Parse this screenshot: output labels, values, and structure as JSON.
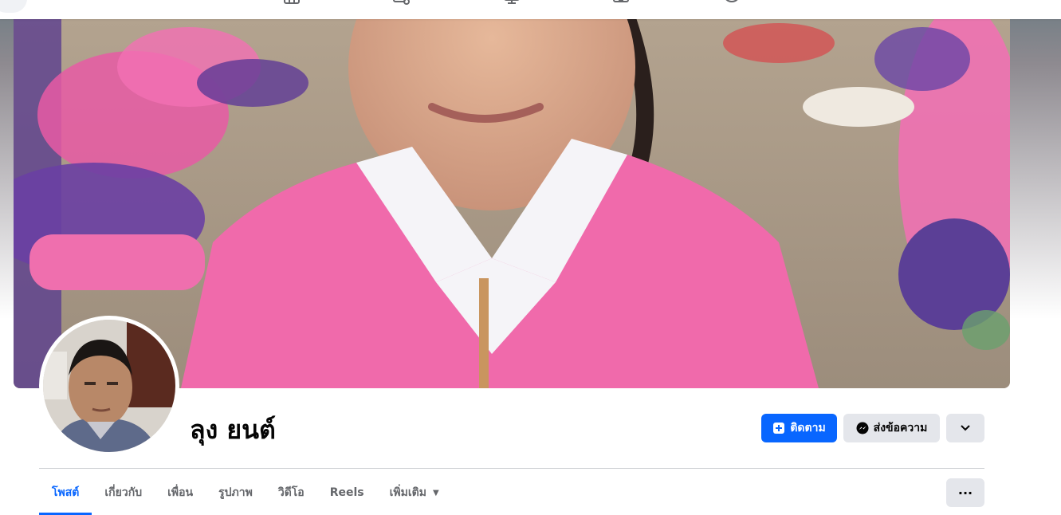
{
  "topnav": {
    "icons": [
      "home-icon",
      "video-icon",
      "marketplace-icon",
      "groups-icon",
      "gaming-icon"
    ]
  },
  "profile": {
    "name": "ลุง ยนต์"
  },
  "actions": {
    "follow_label": "ติดตาม",
    "message_label": "ส่งข้อความ"
  },
  "tabs": [
    {
      "label": "โพสต์"
    },
    {
      "label": "เกี่ยวกับ"
    },
    {
      "label": "เพื่อน"
    },
    {
      "label": "รูปภาพ"
    },
    {
      "label": "วิดีโอ"
    },
    {
      "label": "Reels"
    },
    {
      "label": "เพิ่มเติม"
    }
  ],
  "colors": {
    "accent": "#0866ff",
    "button_gray": "#e4e6eb",
    "text_secondary": "#65676b"
  }
}
